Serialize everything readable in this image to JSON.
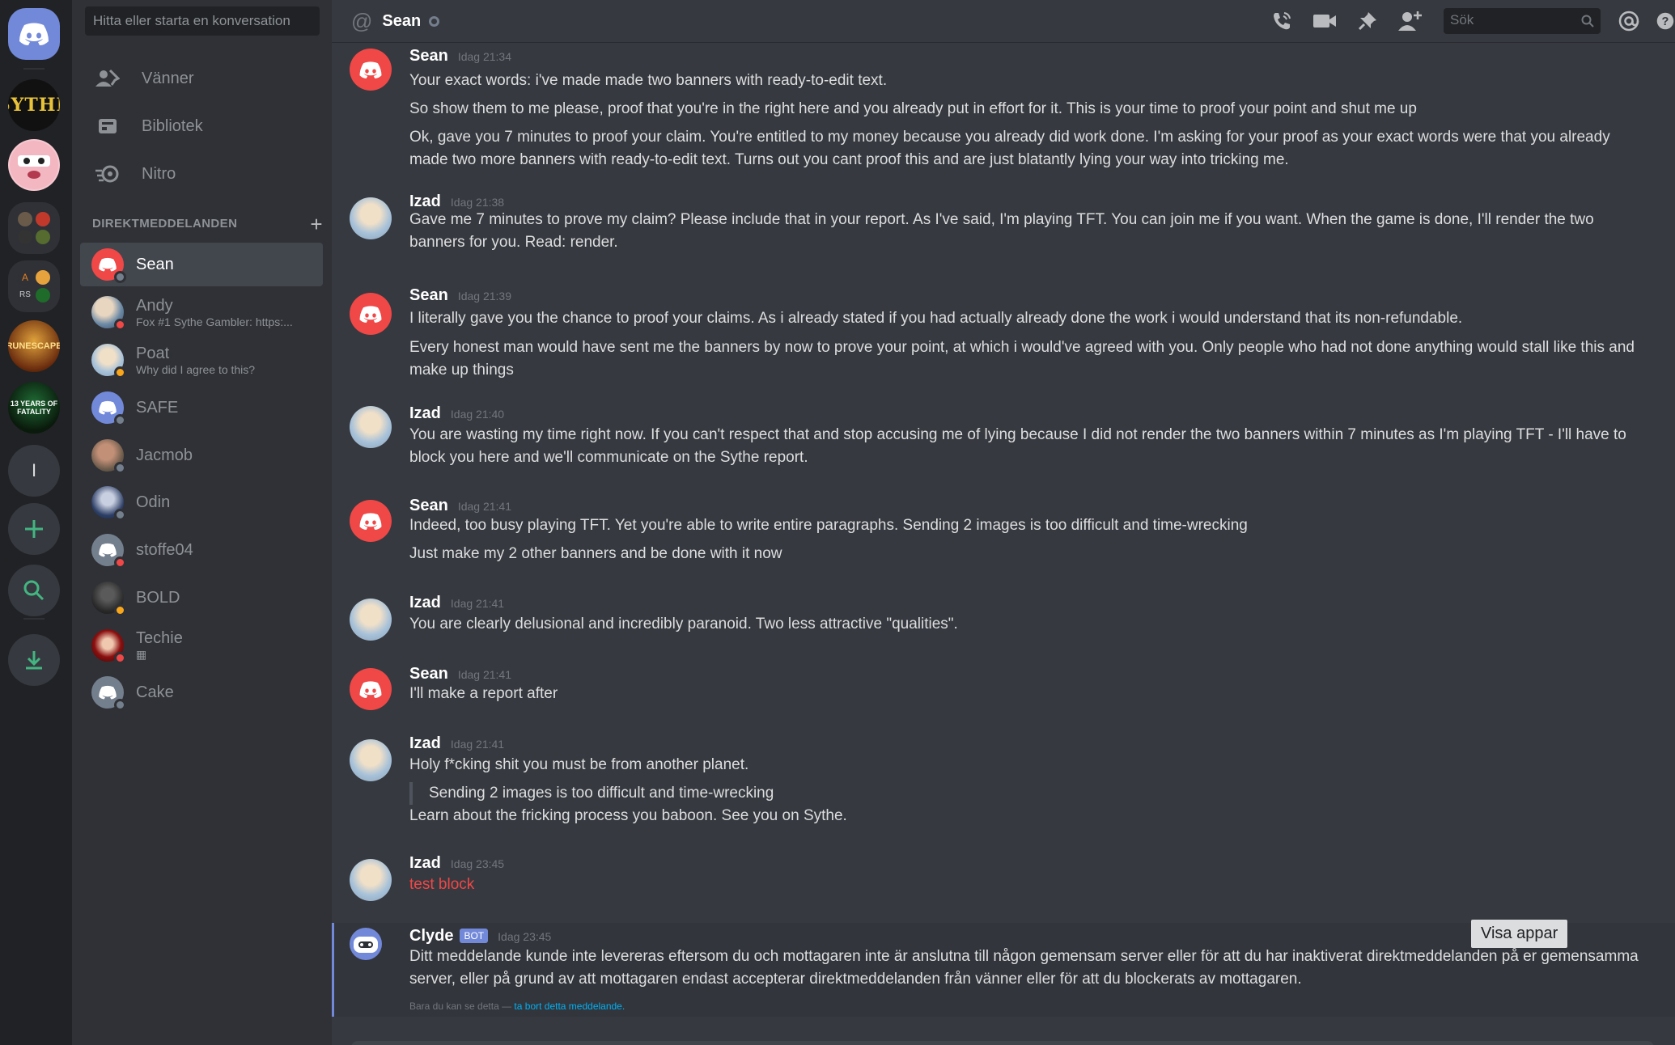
{
  "colors": {
    "rail_bg": "#202225",
    "sidebar_bg": "#2f3136",
    "chat_bg": "#36393f",
    "blurple": "#7289da",
    "red": "#f04747",
    "link": "#00b0f4"
  },
  "servers": {
    "home_icon": "discord-logo-icon",
    "sythe_label": "SYTHE",
    "runescape_label": "RUNESCAPE",
    "fatality_label": "13 YEARS OF FATALITY",
    "initial_label": "I",
    "folder_labels": [
      "A",
      "RS"
    ]
  },
  "sidebar": {
    "search_placeholder": "Hitta eller starta en konversation",
    "nav": [
      {
        "label": "Vänner",
        "icon": "friends-icon"
      },
      {
        "label": "Bibliotek",
        "icon": "library-icon"
      },
      {
        "label": "Nitro",
        "icon": "nitro-icon"
      }
    ],
    "dm_header": "DIREKTMEDDELANDEN",
    "dm_add": "+",
    "dms": [
      {
        "name": "Sean",
        "sub": "",
        "status": "offline",
        "active": true
      },
      {
        "name": "Andy",
        "sub": "Fox #1 Sythe Gambler: https:...",
        "status": "dnd"
      },
      {
        "name": "Poat",
        "sub": "Why did I agree to this?",
        "status": "idle"
      },
      {
        "name": "SAFE",
        "sub": "",
        "status": "offline"
      },
      {
        "name": "Jacmob",
        "sub": "",
        "status": "offline"
      },
      {
        "name": "Odin",
        "sub": "",
        "status": "offline"
      },
      {
        "name": "stoffe04",
        "sub": "",
        "status": "dnd"
      },
      {
        "name": "BOLD",
        "sub": "",
        "status": "idle"
      },
      {
        "name": "Techie",
        "sub": "",
        "status": "dnd"
      },
      {
        "name": "Cake",
        "sub": "",
        "status": "offline"
      }
    ]
  },
  "header": {
    "at_symbol": "@",
    "recipient": "Sean",
    "search_placeholder": "Sök",
    "icons": [
      "voice-call-icon",
      "video-call-icon",
      "pin-icon",
      "add-friend-icon",
      "search-icon",
      "mention-icon",
      "help-icon"
    ]
  },
  "messages": [
    {
      "author": "Sean",
      "time": "Idag 21:34",
      "lines": [
        "Your exact words: i've made made two banners with ready-to-edit text.",
        "So show them to me please, proof that you're in the right here and you already put in effort for it. This is your time to proof your point and shut me up",
        "Ok, gave you 7 minutes to proof your claim. You're entitled to my money because you already did work done. I'm asking for your proof as your exact words were that you already made two more banners with ready-to-edit text. Turns out you cant proof this and are just blatantly lying your way into tricking me."
      ]
    },
    {
      "author": "Izad",
      "time": "Idag 21:38",
      "lines": [
        "Gave me 7 minutes to prove my claim? Please include that in your report. As I've said, I'm playing TFT. You can join me if you want. When the game is done, I'll render the two banners for you. Read: render."
      ]
    },
    {
      "author": "Sean",
      "time": "Idag 21:39",
      "lines": [
        "I literally gave you the chance to proof your claims. As i already stated if you had actually already done the work i would understand that its non-refundable.",
        "Every honest man would have sent me the banners by now to prove your point, at which i would've agreed with you. Only people who had not done anything would stall like this and make up things"
      ]
    },
    {
      "author": "Izad",
      "time": "Idag 21:40",
      "lines": [
        "You are wasting my time right now. If you can't respect that and stop accusing me of lying because I did not render the two banners within 7 minutes as I'm playing TFT - I'll have to block you here and we'll communicate on the Sythe report."
      ]
    },
    {
      "author": "Sean",
      "time": "Idag 21:41",
      "lines": [
        "Indeed, too busy playing TFT. Yet you're able to write entire paragraphs. Sending 2 images is too difficult and time-wrecking",
        "Just make my 2 other banners and be done with it now"
      ]
    },
    {
      "author": "Izad",
      "time": "Idag 21:41",
      "lines": [
        "You are clearly delusional and incredibly paranoid. Two less attractive \"qualities\"."
      ]
    },
    {
      "author": "Sean",
      "time": "Idag 21:41",
      "lines": [
        "I'll make a report after"
      ]
    },
    {
      "author": "Izad",
      "time": "Idag 21:41",
      "lines": [
        "Holy f*cking shit you must be from another planet.",
        "Learn about the fricking process you baboon. See you on Sythe."
      ],
      "quote": "Sending 2 images is too difficult and time-wrecking"
    },
    {
      "author": "Izad",
      "time": "Idag 23:45",
      "lines": [
        "test block"
      ]
    },
    {
      "author": "Clyde",
      "badge": "BOT",
      "time": "Idag 23:45",
      "lines": [
        "Ditt meddelande kunde inte levereras eftersom du och mottagaren inte är anslutna till någon gemensam server eller för att du har inaktiverat direktmeddelanden på er gemensamma server, eller på grund av att mottagaren endast accepterar direktmeddelanden från vänner eller för att du blockerats av mottagaren."
      ],
      "ephemeral_text": "Bara du kan se detta — ",
      "ephemeral_link": "ta bort detta meddelande."
    }
  ],
  "tooltip": {
    "label": "Visa appar"
  }
}
